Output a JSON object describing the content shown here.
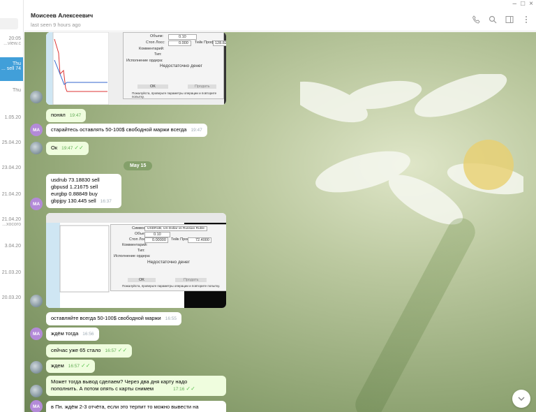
{
  "window": {
    "controls": [
      "–",
      "□",
      "×"
    ]
  },
  "sidebar": {
    "items": [
      {
        "date": "20:05",
        "snippet": "view.c..."
      },
      {
        "date": "Thu",
        "snippet": "74 sell ..."
      },
      {
        "date": "Thu",
        "snippet": ""
      },
      {
        "date": "1.05.20",
        "snippet": ""
      },
      {
        "date": "25.04.20",
        "snippet": ""
      },
      {
        "date": "23.04.20",
        "snippet": ""
      },
      {
        "date": "21.04.20",
        "snippet": ""
      },
      {
        "date": "21.04.20",
        "snippet": "xocoro..."
      },
      {
        "date": "3.04.20",
        "snippet": ""
      },
      {
        "date": "21.03.20",
        "snippet": ""
      },
      {
        "date": "20.03.20",
        "snippet": ""
      }
    ]
  },
  "header": {
    "name": "Моисеев Алексеевич",
    "status": "last seen 9 hours ago",
    "icons": [
      "phone-icon",
      "search-icon",
      "sidebar-toggle-icon",
      "more-icon"
    ]
  },
  "chat": {
    "date_separator": "May 15",
    "avatar_initials": "MA",
    "shot1": {
      "labels": [
        "Объем:",
        "Стоп Лосс:",
        "Тейк Профит:",
        "Комментарий:",
        "Тип:",
        "Исполнение ордера:"
      ],
      "volume": "0.10",
      "stop": "0.000",
      "take": "128.828",
      "message": "Недостаточно денег",
      "buttons": [
        "OK",
        "Продать"
      ],
      "note": "Пожалуйста, проверьте параметры операции и повторите попытку."
    },
    "shot2": {
      "symbol": "USDRUB, US Dollar vs Russian Ruble",
      "labels": [
        "Символ:",
        "Объем:",
        "Стоп Лосс:",
        "Тейк Профит:",
        "Комментарий:",
        "Тип:",
        "Исполнение ордера:"
      ],
      "volume": "0.10",
      "stop": "0.00000",
      "take": "72.4000",
      "message": "Недостаточно денег",
      "buttons": [
        "OK",
        "Продать"
      ],
      "note": "Пожалуйста, проверьте параметры операции и повторите попытку."
    },
    "messages": [
      {
        "text": "понял",
        "time": "19:47"
      },
      {
        "text": "старайтесь оставлять 50-100$ свободной маржи всегда",
        "time": "19:47"
      },
      {
        "text": "Ок",
        "time": "19:47"
      },
      {
        "lines": [
          "usdrub 73.18830 sell",
          "gbpusd 1.21675 sell",
          "eurgbp 0.88849 buy",
          "gbpjpy 130.445 sell"
        ],
        "time": "16:37"
      },
      {
        "text": "оставляйте всегда 50-100$ свободной маржи",
        "time": "16:55"
      },
      {
        "text": "ждём тогда",
        "time": "16:56"
      },
      {
        "text": "сейчас уже 65 стало",
        "time": "16:57"
      },
      {
        "text": "ждем",
        "time": "16:57"
      },
      {
        "lines": [
          "Может тогда вывод сделаем? Через два дня карту надо",
          "пополнить. А потом опять с карты снимем"
        ],
        "time": "17:16"
      },
      {
        "text": "в Пн. ждём 2-3 отчёта, если это терпит то можно вывести на"
      }
    ]
  },
  "colors": {
    "accent": "#419fd9",
    "outgoing": "#effdde",
    "ticks": "#5dc452",
    "avatar": "#b38ad8",
    "date_pill": "#84a06a"
  }
}
